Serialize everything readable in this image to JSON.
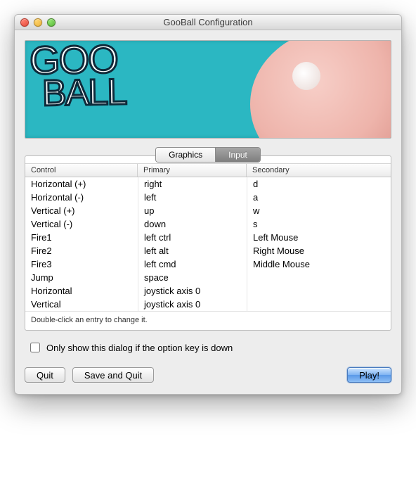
{
  "window": {
    "title": "GooBall Configuration"
  },
  "banner": {
    "line1": "GOO",
    "line2": "BALL"
  },
  "tabs": {
    "graphics": "Graphics",
    "input": "Input",
    "active": "input"
  },
  "table": {
    "headers": {
      "control": "Control",
      "primary": "Primary",
      "secondary": "Secondary"
    },
    "rows": [
      {
        "control": "Horizontal (+)",
        "primary": "right",
        "secondary": "d"
      },
      {
        "control": "Horizontal (-)",
        "primary": "left",
        "secondary": "a"
      },
      {
        "control": "Vertical (+)",
        "primary": "up",
        "secondary": "w"
      },
      {
        "control": "Vertical (-)",
        "primary": "down",
        "secondary": "s"
      },
      {
        "control": "Fire1",
        "primary": "left ctrl",
        "secondary": "Left Mouse"
      },
      {
        "control": "Fire2",
        "primary": "left alt",
        "secondary": "Right Mouse"
      },
      {
        "control": "Fire3",
        "primary": "left cmd",
        "secondary": "Middle Mouse"
      },
      {
        "control": "Jump",
        "primary": "space",
        "secondary": ""
      },
      {
        "control": "Horizontal",
        "primary": "joystick axis 0",
        "secondary": ""
      },
      {
        "control": "Vertical",
        "primary": "joystick axis 0",
        "secondary": ""
      }
    ],
    "hint": "Double-click an entry to change it."
  },
  "checkbox": {
    "label": "Only show this dialog if the option key is down",
    "checked": false
  },
  "buttons": {
    "quit": "Quit",
    "save_quit": "Save and Quit",
    "play": "Play!"
  }
}
